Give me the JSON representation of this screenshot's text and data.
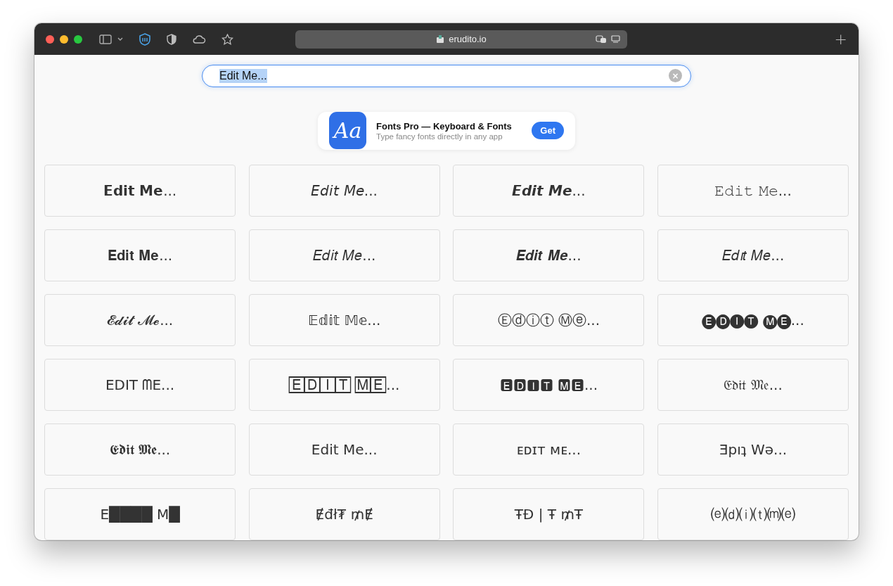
{
  "browser": {
    "url": "erudito.io",
    "new_tab": "+"
  },
  "search": {
    "value": "Edit Me...",
    "selected": true,
    "clear": "×"
  },
  "ad": {
    "icon_text": "Aa",
    "title": "Fonts Pro — Keyboard & Fonts",
    "subtitle": "Type fancy fonts directly in any app",
    "button": "Get"
  },
  "cards": [
    {
      "text": "𝗘𝗱𝗶𝘁 𝗠𝗲..."
    },
    {
      "text": "𝘌𝘥𝘪𝘵 𝘔𝘦..."
    },
    {
      "text": "𝙀𝙙𝙞𝙩 𝙈𝙚..."
    },
    {
      "text": "𝙴𝚍𝚒𝚝 𝙼𝚎..."
    },
    {
      "text": "𝐄𝐝𝐢𝐭 𝐌𝐞..."
    },
    {
      "text": "𝐸𝑑𝑖𝑡 𝑀𝑒..."
    },
    {
      "text": "𝑬𝒅𝒊𝒕 𝑴𝒆..."
    },
    {
      "text": "𝐸𝑑𝚤𝑡 𝑀𝑒..."
    },
    {
      "text": "𝓔𝓭𝓲𝓽 𝓜𝓮..."
    },
    {
      "text": "𝔼𝕕𝕚𝕥 𝕄𝕖..."
    },
    {
      "text": "Ⓔⓓⓘⓣ Ⓜⓔ..."
    },
    {
      "text": "🅔🅓🅘🅣 🅜🅔..."
    },
    {
      "text": "EDIT ᗰE..."
    },
    {
      "text": "🄴🄳🄸🅃 🄼🄴..."
    },
    {
      "text": "🅴🅳🅸🆃 🅼🅴..."
    },
    {
      "text": "𝔈𝔡𝔦𝔱 𝔐𝔢..."
    },
    {
      "text": "𝕰𝖉𝖎𝖙 𝕸𝖊..."
    },
    {
      "text": "Edit Me..."
    },
    {
      "text": "ᴇᴅɪᴛ ᴍᴇ..."
    },
    {
      "text": "Ǝpıʇ Wǝ..."
    },
    {
      "text": "E████ M█"
    },
    {
      "text": "Ɇđł₮ ₥Ɇ"
    },
    {
      "text": "ŦĐ | Ŧ ₥Ŧ"
    },
    {
      "text": "⒠⒟⒤⒯⒨⒠"
    }
  ]
}
